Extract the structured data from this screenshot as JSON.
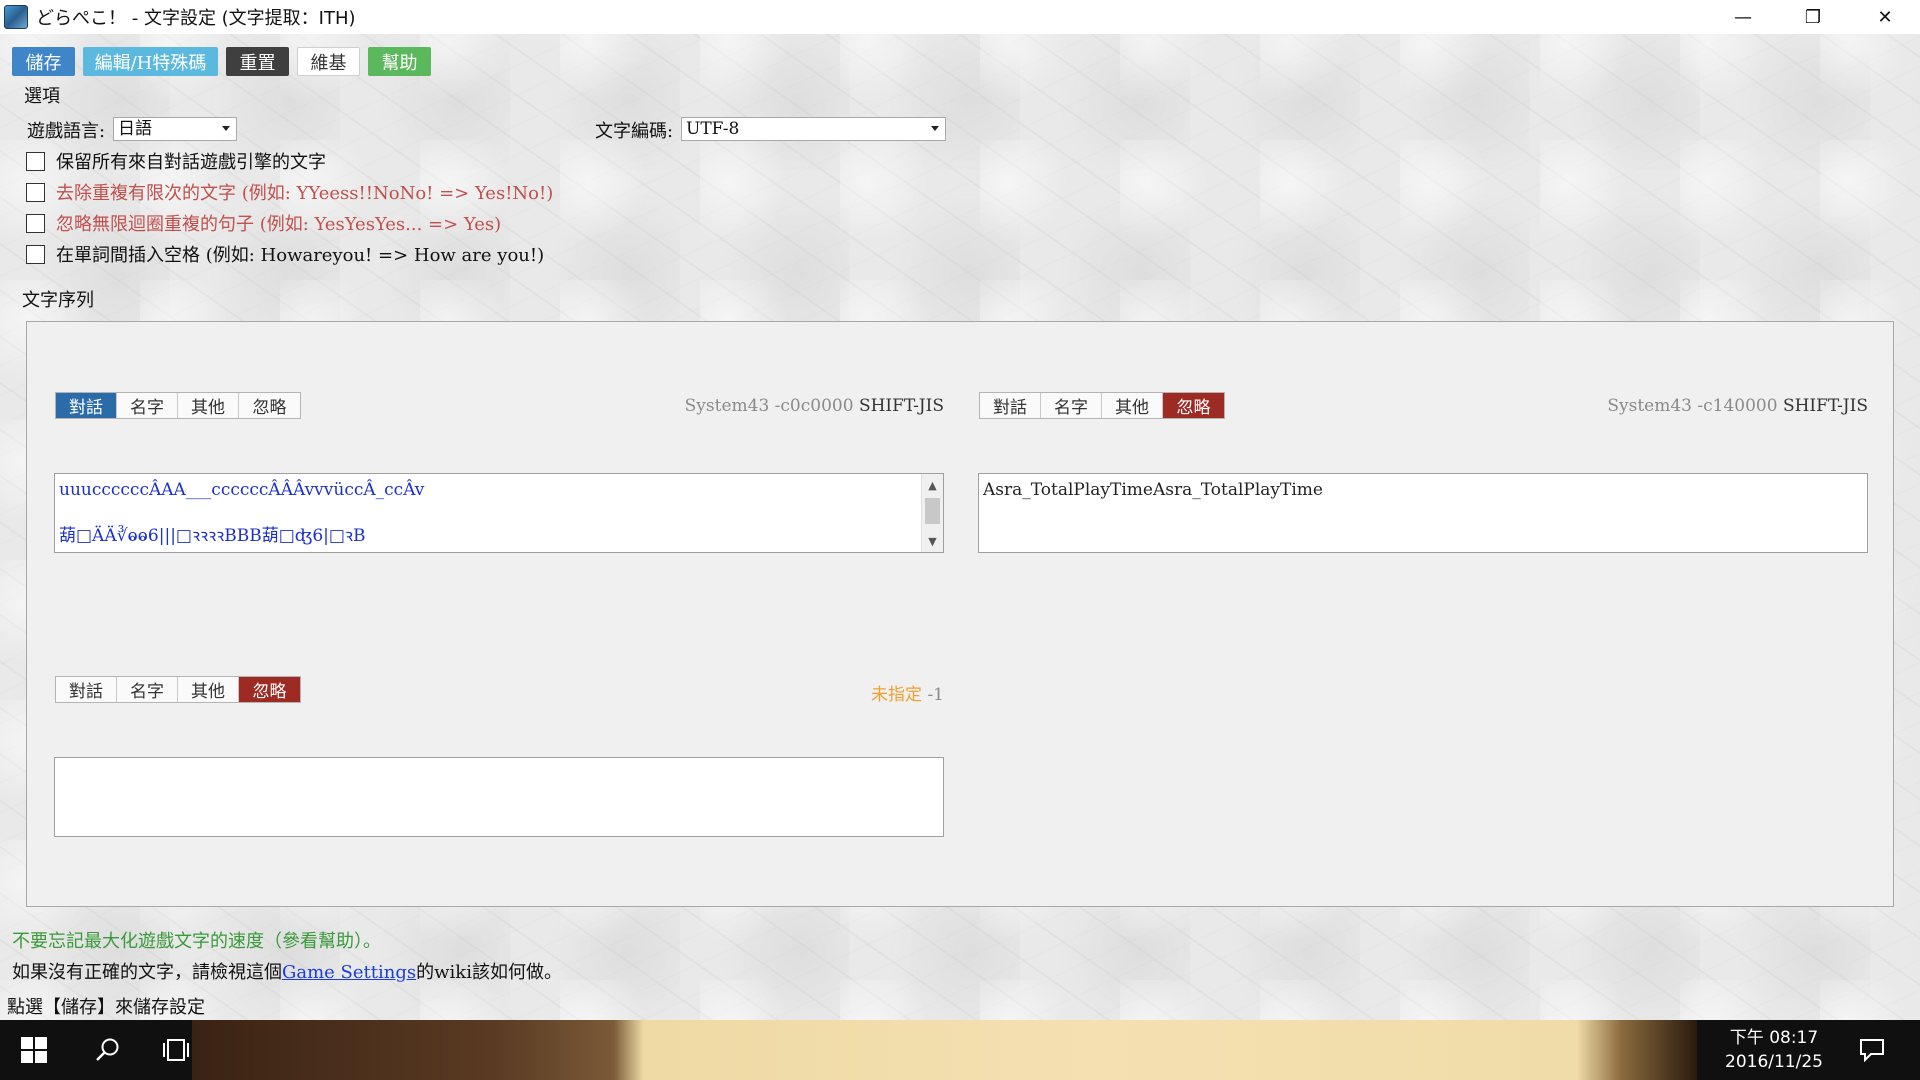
{
  "window": {
    "title": "どらぺこ！ - 文字設定 (文字提取：ITH)",
    "minimize": "—",
    "restore": "❐",
    "close": "✕"
  },
  "toolbar": {
    "save": "儲存",
    "edit_h_code": "編輯/H特殊碼",
    "reset": "重置",
    "wiki": "維基",
    "help": "幫助",
    "colors": {
      "save": "#3f86c9",
      "edit": "#5bb8df",
      "reset": "#3f3f3f",
      "wiki": "#ffffff",
      "help": "#5cb85c"
    }
  },
  "options": {
    "heading": "選項",
    "game_language_label": "遊戲語言:",
    "game_language_value": "日語",
    "text_encoding_label": "文字編碼:",
    "text_encoding_value": "UTF-8",
    "checkboxes": [
      {
        "label": "保留所有來自對話遊戲引擎的文字",
        "checked": false,
        "color": "#111111"
      },
      {
        "label": "去除重複有限次的文字 (例如: YYeess!!NoNo! => Yes!No!)",
        "checked": false,
        "color": "#c0504d"
      },
      {
        "label": "忽略無限迴圈重複的句子 (例如: YesYesYes... => Yes)",
        "checked": false,
        "color": "#c0504d"
      },
      {
        "label": "在單詞間插入空格 (例如: Howareyou! => How are you!)",
        "checked": false,
        "color": "#111111"
      }
    ]
  },
  "text_threads": {
    "heading": "文字序列",
    "segment_labels": [
      "對話",
      "名字",
      "其他",
      "忽略"
    ],
    "threads": [
      {
        "active": "對話",
        "engine": "System43 -c0c0000",
        "encoding": "SHIFT-JIS",
        "lines": [
          "uuuccccccÂAA___ccccccÂÂÂvvvüccÂ_ccÂv",
          "葫□ÄÄ∛ⱺⱺ6|||□ꝛꝛꝛꝛBBB葫□ʤ6|□ꝛB"
        ]
      },
      {
        "active": "忽略",
        "engine": "System43 -c140000",
        "encoding": "SHIFT-JIS",
        "lines": [
          "Asra_TotalPlayTimeAsra_TotalPlayTime"
        ]
      },
      {
        "active": "忽略",
        "engine": "未指定",
        "encoding": "-1",
        "lines": []
      }
    ]
  },
  "footer": {
    "tip": "不要忘記最大化遊戲文字的速度（參看幫助）。",
    "no_text_prefix": "如果沒有正確的文字，請檢視這個",
    "link": "Game Settings",
    "no_text_suffix": "的wiki該如何做。",
    "save_hint": "點選【儲存】來儲存設定"
  },
  "taskbar": {
    "time": "下午 08:17",
    "date": "2016/11/25",
    "start_icon": "windows-logo-icon",
    "search_icon": "search-icon",
    "task_view_icon": "task-view-icon",
    "notification_icon": "action-center-icon"
  }
}
